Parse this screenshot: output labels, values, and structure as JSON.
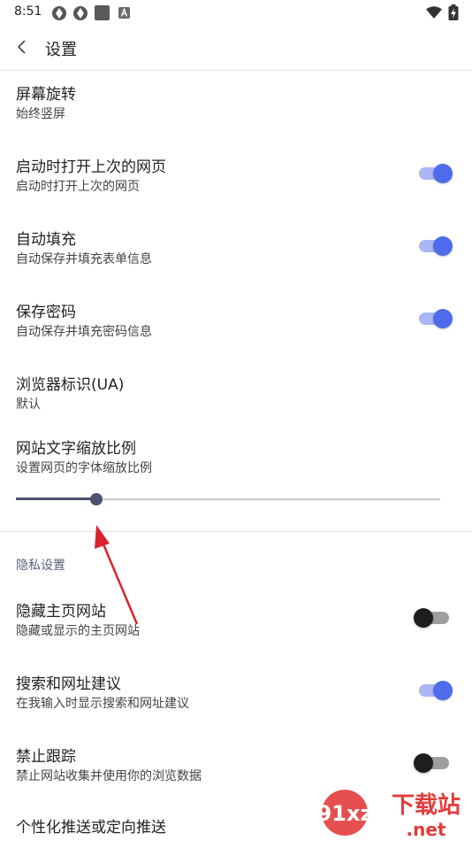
{
  "status_bar": {
    "time": "8:51",
    "left_icons": [
      "app-icon",
      "app-icon",
      "square-icon",
      "a-icon"
    ],
    "right_icons": [
      "wifi-icon",
      "battery-charging-icon"
    ]
  },
  "app_bar": {
    "title": "设置",
    "back_icon": "back-chevron-icon"
  },
  "colors": {
    "accent": "#4d6bea",
    "switch_track_on": "#a9b7f4",
    "slider": "#4a5270",
    "section": "#58627a",
    "arrow": "#d9232a"
  },
  "settings": {
    "screen_rotation": {
      "title": "屏幕旋转",
      "summary": "始终竖屏"
    },
    "restore_tabs": {
      "title": "启动时打开上次的网页",
      "summary": "启动时打开上次的网页",
      "enabled": true
    },
    "autofill": {
      "title": "自动填充",
      "summary": "自动保存并填充表单信息",
      "enabled": true
    },
    "save_password": {
      "title": "保存密码",
      "summary": "自动保存并填充密码信息",
      "enabled": true
    },
    "user_agent": {
      "title": "浏览器标识(UA)",
      "summary": "默认"
    },
    "text_zoom": {
      "title": "网站文字缩放比例",
      "summary": "设置网页的字体缩放比例",
      "slider_value": 0.19
    }
  },
  "privacy": {
    "header": "隐私设置",
    "hide_home_sites": {
      "title": "隐藏主页网站",
      "summary": "隐藏或显示的主页网站",
      "enabled": false
    },
    "search_suggestions": {
      "title": "搜索和网址建议",
      "summary": "在我输入时显示搜索和网址建议",
      "enabled": true
    },
    "do_not_track": {
      "title": "禁止跟踪",
      "summary": "禁止网站收集并使用你的浏览数据",
      "enabled": false
    },
    "personalized_push": {
      "title": "个性化推送或定向推送"
    }
  },
  "watermark": {
    "brand": "下载站",
    "domain": ".net",
    "numeral": "91xz"
  }
}
